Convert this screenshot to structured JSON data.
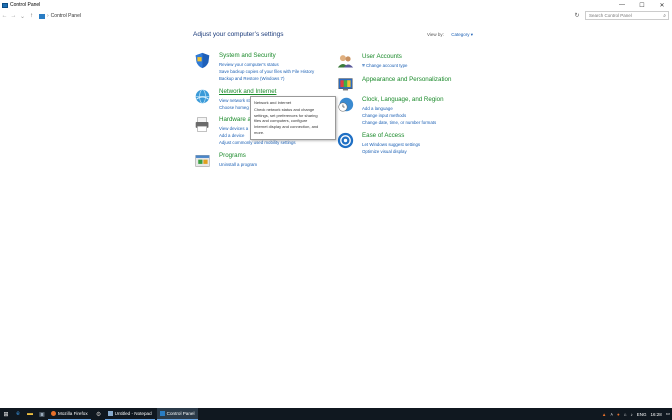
{
  "window": {
    "title": "Control Panel",
    "controls": [
      "—",
      "☐",
      "✕"
    ]
  },
  "address": {
    "breadcrumb": "Control Panel",
    "search_placeholder": "Search Control Panel"
  },
  "page": {
    "heading": "Adjust your computer’s settings",
    "view_by_label": "View by:",
    "view_by_value": "Category ▾"
  },
  "categories": {
    "system": {
      "title": "System and Security",
      "links": [
        "Review your computer's status",
        "Save backup copies of your files with File History",
        "Backup and Restore (Windows 7)"
      ]
    },
    "network": {
      "title": "Network and Internet",
      "links": [
        "View network st",
        "Choose homeg"
      ]
    },
    "hardware": {
      "title": "Hardware a",
      "links": [
        "View devices a",
        "Add a device",
        "Adjust commonly used mobility settings"
      ]
    },
    "programs": {
      "title": "Programs",
      "links": [
        "Uninstall a program"
      ]
    },
    "user_accounts": {
      "title": "User Accounts",
      "links": [
        "Change account type"
      ]
    },
    "appearance": {
      "title": "Appearance and Personalization",
      "links": []
    },
    "clock": {
      "title": "Clock, Language, and Region",
      "links": [
        "Add a language",
        "Change input methods",
        "Change date, time, or number formats"
      ]
    },
    "ease": {
      "title": "Ease of Access",
      "links": [
        "Let Windows suggest settings",
        "Optimize visual display"
      ]
    }
  },
  "tooltip": {
    "lines": [
      "Network and Internet",
      "Check network status and change",
      "settings, set preferences for sharing",
      "files and computers, configure",
      "Internet display and connection, and",
      "more."
    ]
  },
  "taskbar": {
    "apps": [
      "Mozilla Firefox",
      "Untitled - Notepad",
      "Control Panel"
    ],
    "lang": "ENG",
    "time": "16:28"
  },
  "colors": {
    "title_green": "#1a8a2a",
    "link_blue": "#1a5fb4",
    "heading_navy": "#1a3a7a",
    "taskbar": "#101820"
  }
}
